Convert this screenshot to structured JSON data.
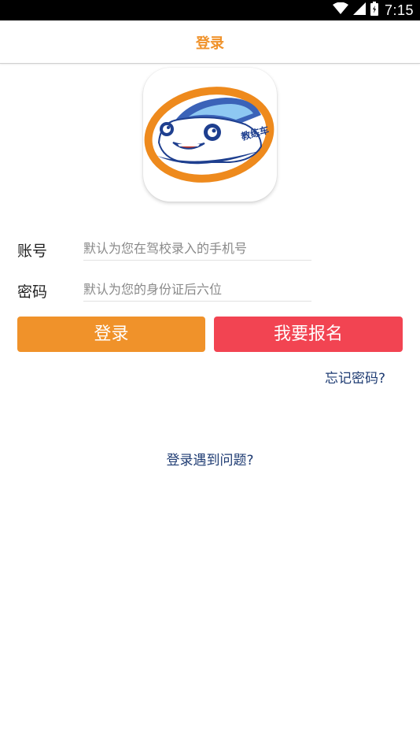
{
  "status_bar": {
    "time": "7:15",
    "icons": [
      "wifi-icon",
      "cellular-signal-icon",
      "battery-icon"
    ]
  },
  "header": {
    "title": "登录"
  },
  "logo": {
    "badge_text": "教练车",
    "icon": "car-mascot-logo"
  },
  "form": {
    "account": {
      "label": "账号",
      "placeholder": "默认为您在驾校录入的手机号",
      "value": ""
    },
    "password": {
      "label": "密码",
      "placeholder": "默认为您的身份证后六位",
      "value": ""
    }
  },
  "actions": {
    "login_label": "登录",
    "register_label": "我要报名",
    "forgot_password": "忘记密码?",
    "login_problem": "登录遇到问题?"
  },
  "colors": {
    "accent_orange": "#f0922a",
    "register_red": "#f24452",
    "link_blue": "#1f3c73"
  }
}
